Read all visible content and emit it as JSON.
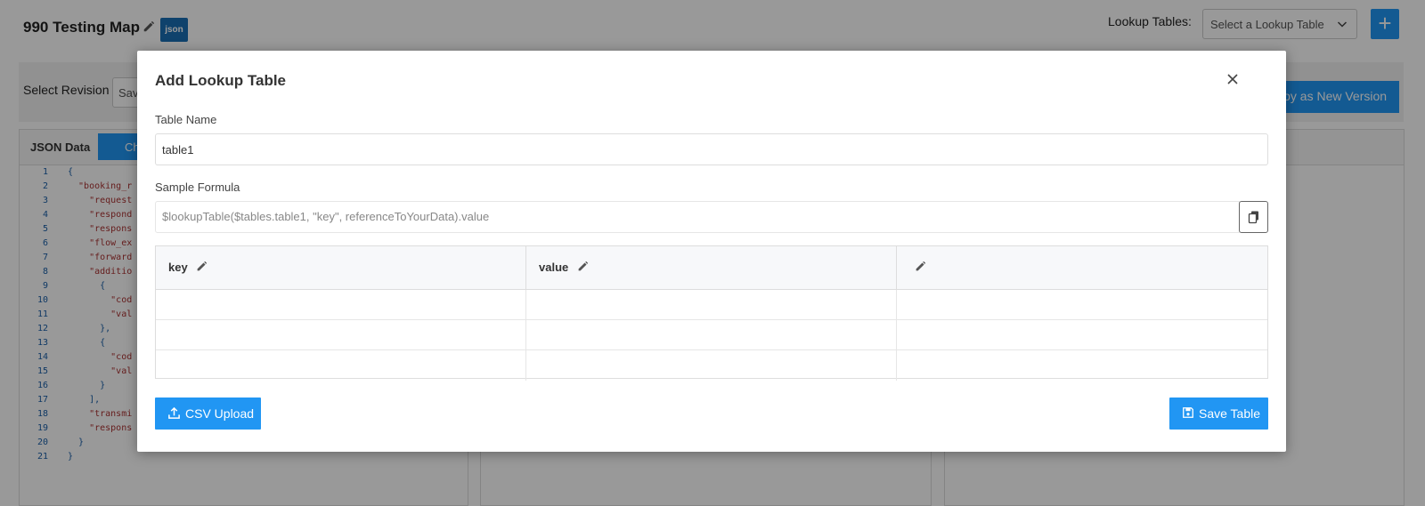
{
  "app": {
    "map_title": "990 Testing Map",
    "json_badge": "json",
    "lookup_tables_label": "Lookup Tables:",
    "lookup_select_placeholder": "Select a Lookup Table",
    "add_button": "+"
  },
  "revision": {
    "label": "Select Revision",
    "select_value": "Sav",
    "deploy_button": "loy as New Version"
  },
  "json_panel": {
    "title": "JSON Data",
    "button_label": "Ch",
    "lines": [
      {
        "n": "1",
        "text": "{"
      },
      {
        "n": "2",
        "text": "  \"booking_r"
      },
      {
        "n": "3",
        "text": "    \"request"
      },
      {
        "n": "4",
        "text": "    \"respond"
      },
      {
        "n": "5",
        "text": "    \"respons"
      },
      {
        "n": "6",
        "text": "    \"flow_ex"
      },
      {
        "n": "7",
        "text": "    \"forward"
      },
      {
        "n": "8",
        "text": "    \"additio"
      },
      {
        "n": "9",
        "text": "      {"
      },
      {
        "n": "10",
        "text": "        \"cod"
      },
      {
        "n": "11",
        "text": "        \"val"
      },
      {
        "n": "12",
        "text": "      },"
      },
      {
        "n": "13",
        "text": "      {"
      },
      {
        "n": "14",
        "text": "        \"cod"
      },
      {
        "n": "15",
        "text": "        \"val"
      },
      {
        "n": "16",
        "text": "      }"
      },
      {
        "n": "17",
        "text": "    ],"
      },
      {
        "n": "18",
        "text": "    \"transmi"
      },
      {
        "n": "19",
        "text": "    \"respons"
      },
      {
        "n": "20",
        "text": "  }"
      },
      {
        "n": "21",
        "text": "}"
      }
    ]
  },
  "modal": {
    "title": "Add Lookup Table",
    "table_name_label": "Table Name",
    "table_name_value": "table1",
    "sample_formula_label": "Sample Formula",
    "sample_formula_value": "$lookupTable($tables.table1, \"key\", referenceToYourData).value",
    "columns": [
      {
        "label": "key"
      },
      {
        "label": "value"
      },
      {
        "label": ""
      }
    ],
    "rows": [
      [
        "",
        "",
        ""
      ],
      [
        "",
        "",
        ""
      ],
      [
        "",
        "",
        ""
      ]
    ],
    "csv_upload_button": "CSV Upload",
    "save_table_button": "Save Table"
  },
  "colors": {
    "primary": "#2196f3",
    "badge": "#1a6fb5"
  }
}
